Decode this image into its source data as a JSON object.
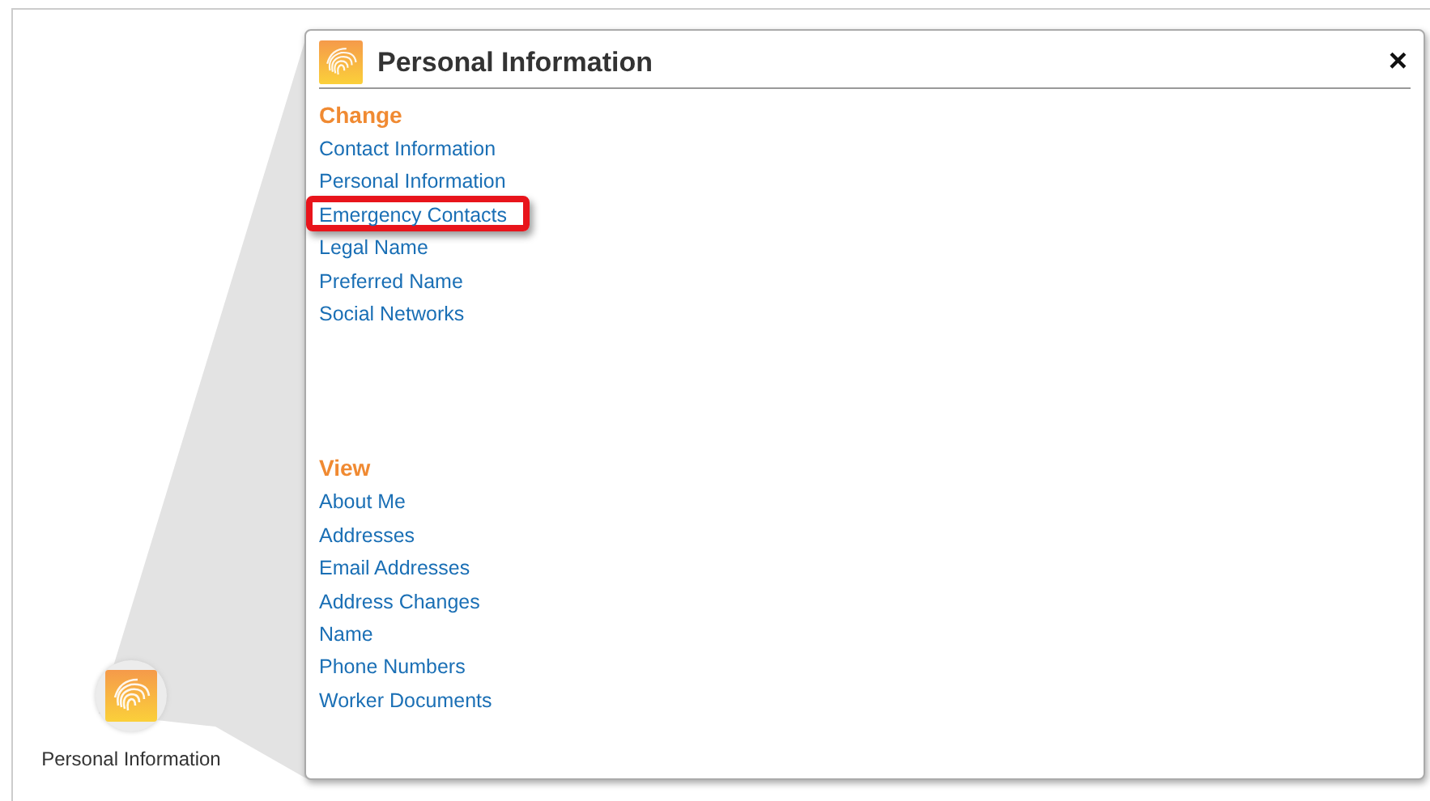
{
  "launcher": {
    "label": "Personal Information"
  },
  "popup": {
    "title": "Personal Information",
    "close": "×"
  },
  "sections": [
    {
      "heading": "Change",
      "links": [
        {
          "label": "Contact Information",
          "highlighted": false
        },
        {
          "label": "Personal Information",
          "highlighted": false
        },
        {
          "label": "Emergency Contacts",
          "highlighted": true
        },
        {
          "label": "Legal Name",
          "highlighted": false
        },
        {
          "label": "Preferred Name",
          "highlighted": false
        },
        {
          "label": "Social Networks",
          "highlighted": false
        }
      ]
    },
    {
      "heading": "View",
      "links": [
        {
          "label": "About Me",
          "highlighted": false
        },
        {
          "label": "Addresses",
          "highlighted": false
        },
        {
          "label": "Email Addresses",
          "highlighted": false
        },
        {
          "label": "Address Changes",
          "highlighted": false
        },
        {
          "label": "Name",
          "highlighted": false
        },
        {
          "label": "Phone Numbers",
          "highlighted": false
        },
        {
          "label": "Worker Documents",
          "highlighted": false
        }
      ]
    }
  ]
}
